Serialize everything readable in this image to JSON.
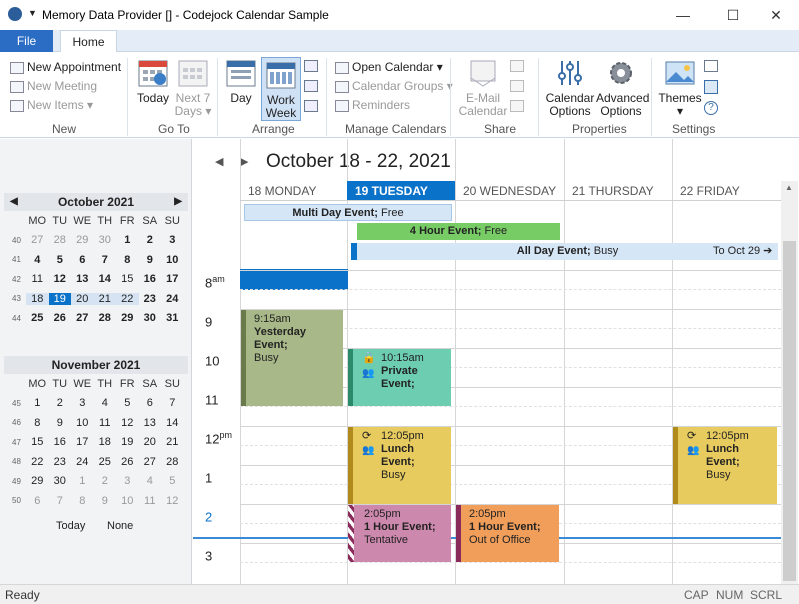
{
  "window": {
    "title": "Memory Data Provider [] - Codejock Calendar Sample",
    "minimize": "—",
    "maximize": "☐",
    "close": "✕"
  },
  "tabs": {
    "file": "File",
    "home": "Home"
  },
  "ribbon": {
    "new": {
      "appointment": "New Appointment",
      "meeting": "New Meeting",
      "items": "New Items",
      "group": "New"
    },
    "goto": {
      "today": "Today",
      "next7_line1": "Next 7",
      "next7_line2": "Days",
      "group": "Go To"
    },
    "arrange": {
      "day": "Day",
      "work_line1": "Work",
      "work_line2": "Week",
      "group": "Arrange"
    },
    "manage": {
      "open": "Open Calendar",
      "groups": "Calendar Groups",
      "reminders": "Reminders",
      "group": "Manage Calendars"
    },
    "share": {
      "email_line1": "E-Mail",
      "email_line2": "Calendar",
      "group": "Share"
    },
    "properties": {
      "cal_line1": "Calendar",
      "cal_line2": "Options",
      "adv_line1": "Advanced",
      "adv_line2": "Options",
      "group": "Properties"
    },
    "settings": {
      "themes": "Themes",
      "group": "Settings"
    }
  },
  "mini_oct": {
    "title": "October 2021",
    "dows": [
      "MO",
      "TU",
      "WE",
      "TH",
      "FR",
      "SA",
      "SU"
    ],
    "weeks": [
      {
        "wk": "40",
        "days": [
          "27",
          "28",
          "29",
          "30",
          "1",
          "2",
          "3"
        ]
      },
      {
        "wk": "41",
        "days": [
          "4",
          "5",
          "6",
          "7",
          "8",
          "9",
          "10"
        ]
      },
      {
        "wk": "42",
        "days": [
          "11",
          "12",
          "13",
          "14",
          "15",
          "16",
          "17"
        ]
      },
      {
        "wk": "43",
        "days": [
          "18",
          "19",
          "20",
          "21",
          "22",
          "23",
          "24"
        ]
      },
      {
        "wk": "44",
        "days": [
          "25",
          "26",
          "27",
          "28",
          "29",
          "30",
          "31"
        ]
      }
    ]
  },
  "mini_nov": {
    "title": "November 2021",
    "dows": [
      "MO",
      "TU",
      "WE",
      "TH",
      "FR",
      "SA",
      "SU"
    ],
    "weeks": [
      {
        "wk": "45",
        "days": [
          "1",
          "2",
          "3",
          "4",
          "5",
          "6",
          "7"
        ]
      },
      {
        "wk": "46",
        "days": [
          "8",
          "9",
          "10",
          "11",
          "12",
          "13",
          "14"
        ]
      },
      {
        "wk": "47",
        "days": [
          "15",
          "16",
          "17",
          "18",
          "19",
          "20",
          "21"
        ]
      },
      {
        "wk": "48",
        "days": [
          "22",
          "23",
          "24",
          "25",
          "26",
          "27",
          "28"
        ]
      },
      {
        "wk": "49",
        "days": [
          "29",
          "30",
          "1",
          "2",
          "3",
          "4",
          "5"
        ]
      },
      {
        "wk": "50",
        "days": [
          "6",
          "7",
          "8",
          "9",
          "10",
          "11",
          "12"
        ]
      }
    ]
  },
  "mini_footer": {
    "today": "Today",
    "none": "None"
  },
  "calendar": {
    "range_title": "October 18 - 22, 2021",
    "days": [
      "18 MONDAY",
      "19 TUESDAY",
      "20 WEDNESDAY",
      "21 THURSDAY",
      "22 FRIDAY"
    ],
    "hours": [
      {
        "h": "8",
        "s": "am"
      },
      {
        "h": "9",
        "s": ""
      },
      {
        "h": "10",
        "s": ""
      },
      {
        "h": "11",
        "s": ""
      },
      {
        "h": "12",
        "s": "pm"
      },
      {
        "h": "1",
        "s": ""
      },
      {
        "h": "2",
        "s": ""
      },
      {
        "h": "3",
        "s": ""
      }
    ],
    "banners": {
      "multi": {
        "name": "Multi Day Event;",
        "status": "Free"
      },
      "four": {
        "name": "4 Hour Event;",
        "status": "Free"
      },
      "allday": {
        "name": "All Day Event;",
        "status": "Busy",
        "to": "To Oct 29"
      }
    },
    "events": {
      "yesterday": {
        "time": "9:15am",
        "name": "Yesterday Event;",
        "status": "Busy"
      },
      "private": {
        "time": "10:15am",
        "name": "Private",
        "name2": "Event;"
      },
      "lunch1": {
        "time": "12:05pm",
        "name": "Lunch Event;",
        "status": "Busy"
      },
      "lunch2": {
        "time": "12:05pm",
        "name": "Lunch Event;",
        "status": "Busy"
      },
      "hour1": {
        "time": "2:05pm",
        "name": "1 Hour Event;",
        "status": "Tentative"
      },
      "hour2": {
        "time": "2:05pm",
        "name": "1 Hour Event;",
        "status": "Out of Office"
      }
    },
    "colors": {
      "today": "#0a72c9",
      "yesterday": "#a8b888",
      "private": "#6dcdb0",
      "lunch": "#e8cb5e",
      "tentative": "#cd88ad",
      "out": "#f19e5b",
      "four": "#77cc66",
      "multi": "#d5e6f7"
    }
  },
  "status": {
    "left": "Ready",
    "cap": "CAP",
    "num": "NUM",
    "scrl": "SCRL"
  }
}
